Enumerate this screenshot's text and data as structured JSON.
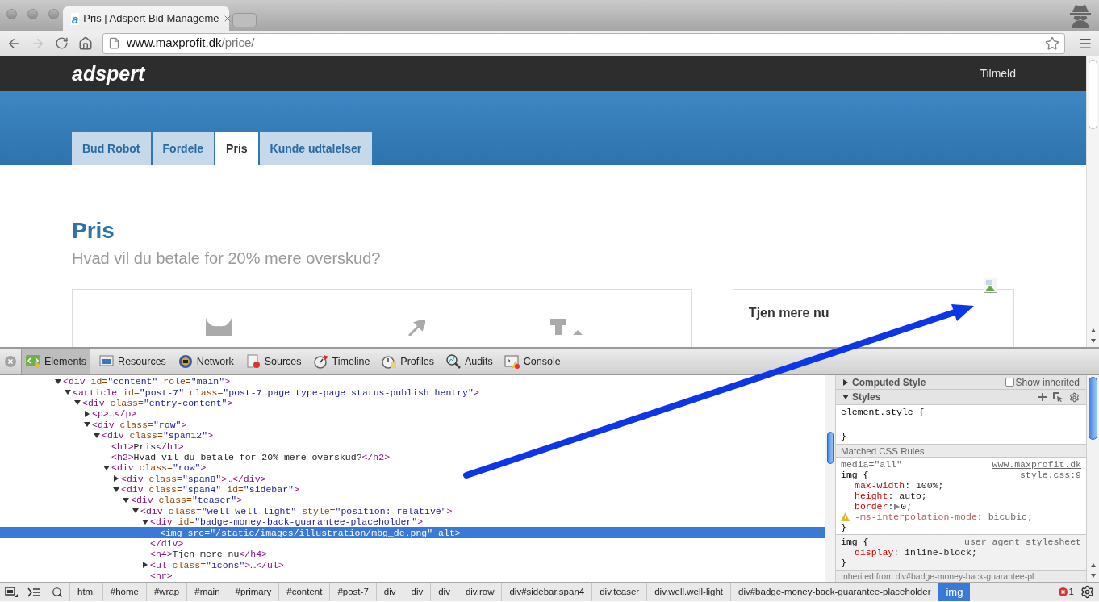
{
  "browser": {
    "tab": {
      "favicon_letter": "a",
      "title": "Pris | Adspert Bid Manageme"
    },
    "url": {
      "host": "www.maxprofit.dk",
      "path": "/price/"
    },
    "forward_disabled": true
  },
  "site": {
    "logo": "adspert",
    "signup": "Tilmeld",
    "nav": [
      {
        "label": "Bud Robot",
        "selected": false
      },
      {
        "label": "Fordele",
        "selected": false
      },
      {
        "label": "Pris",
        "selected": true
      },
      {
        "label": "Kunde udtalelser",
        "selected": false
      }
    ],
    "heading": "Pris",
    "subheading": "Hvad vil du betale for 20% mere overskud?",
    "sidebar_title": "Tjen mere nu"
  },
  "devtools": {
    "tabs": [
      {
        "label": "Elements",
        "selected": true
      },
      {
        "label": "Resources",
        "selected": false
      },
      {
        "label": "Network",
        "selected": false
      },
      {
        "label": "Sources",
        "selected": false
      },
      {
        "label": "Timeline",
        "selected": false
      },
      {
        "label": "Profiles",
        "selected": false
      },
      {
        "label": "Audits",
        "selected": false
      },
      {
        "label": "Console",
        "selected": false
      }
    ],
    "dom_tree": [
      {
        "expanded": true,
        "selected": false,
        "tokens": [
          {
            "kind": "tag",
            "text": "<div"
          },
          {
            "kind": "attr",
            "text": " id="
          },
          {
            "kind": "val",
            "text": "\"content\""
          },
          {
            "kind": "attr",
            "text": " role="
          },
          {
            "kind": "val",
            "text": "\"main\""
          },
          {
            "kind": "tag",
            "text": ">"
          }
        ],
        "children": [
          {
            "expanded": true,
            "selected": false,
            "tokens": [
              {
                "kind": "tag",
                "text": "<article"
              },
              {
                "kind": "attr",
                "text": " id="
              },
              {
                "kind": "val",
                "text": "\"post-7\""
              },
              {
                "kind": "attr",
                "text": " class="
              },
              {
                "kind": "val",
                "text": "\"post-7 page type-page status-publish hentry\""
              },
              {
                "kind": "tag",
                "text": ">"
              }
            ],
            "children": [
              {
                "expanded": true,
                "selected": false,
                "tokens": [
                  {
                    "kind": "tag",
                    "text": "<div"
                  },
                  {
                    "kind": "attr",
                    "text": " class="
                  },
                  {
                    "kind": "val",
                    "text": "\"entry-content\""
                  },
                  {
                    "kind": "tag",
                    "text": ">"
                  }
                ],
                "children": [
                  {
                    "expanded": false,
                    "selected": false,
                    "tokens": [
                      {
                        "kind": "tag",
                        "text": "<p>"
                      },
                      {
                        "kind": "text",
                        "text": "…"
                      },
                      {
                        "kind": "tag",
                        "text": "</p>"
                      }
                    ]
                  },
                  {
                    "expanded": true,
                    "selected": false,
                    "tokens": [
                      {
                        "kind": "tag",
                        "text": "<div"
                      },
                      {
                        "kind": "attr",
                        "text": " class="
                      },
                      {
                        "kind": "val",
                        "text": "\"row\""
                      },
                      {
                        "kind": "tag",
                        "text": ">"
                      }
                    ],
                    "children": [
                      {
                        "expanded": true,
                        "selected": false,
                        "tokens": [
                          {
                            "kind": "tag",
                            "text": "<div"
                          },
                          {
                            "kind": "attr",
                            "text": " class="
                          },
                          {
                            "kind": "val",
                            "text": "\"span12\""
                          },
                          {
                            "kind": "tag",
                            "text": ">"
                          }
                        ],
                        "children": [
                          {
                            "selected": false,
                            "tokens": [
                              {
                                "kind": "tag",
                                "text": "<h1>"
                              },
                              {
                                "kind": "text",
                                "text": "Pris"
                              },
                              {
                                "kind": "tag",
                                "text": "</h1>"
                              }
                            ]
                          },
                          {
                            "selected": false,
                            "tokens": [
                              {
                                "kind": "tag",
                                "text": "<h2>"
                              },
                              {
                                "kind": "text",
                                "text": "Hvad vil du betale for 20% mere overskud?"
                              },
                              {
                                "kind": "tag",
                                "text": "</h2>"
                              }
                            ]
                          },
                          {
                            "expanded": true,
                            "selected": false,
                            "tokens": [
                              {
                                "kind": "tag",
                                "text": "<div"
                              },
                              {
                                "kind": "attr",
                                "text": " class="
                              },
                              {
                                "kind": "val",
                                "text": "\"row\""
                              },
                              {
                                "kind": "tag",
                                "text": ">"
                              }
                            ],
                            "children": [
                              {
                                "expanded": false,
                                "selected": false,
                                "tokens": [
                                  {
                                    "kind": "tag",
                                    "text": "<div"
                                  },
                                  {
                                    "kind": "attr",
                                    "text": " class="
                                  },
                                  {
                                    "kind": "val",
                                    "text": "\"span8\""
                                  },
                                  {
                                    "kind": "tag",
                                    "text": ">"
                                  },
                                  {
                                    "kind": "text",
                                    "text": "…"
                                  },
                                  {
                                    "kind": "tag",
                                    "text": "</div>"
                                  }
                                ]
                              },
                              {
                                "expanded": true,
                                "selected": false,
                                "tokens": [
                                  {
                                    "kind": "tag",
                                    "text": "<div"
                                  },
                                  {
                                    "kind": "attr",
                                    "text": " class="
                                  },
                                  {
                                    "kind": "val",
                                    "text": "\"span4\""
                                  },
                                  {
                                    "kind": "attr",
                                    "text": " id="
                                  },
                                  {
                                    "kind": "val",
                                    "text": "\"sidebar\""
                                  },
                                  {
                                    "kind": "tag",
                                    "text": ">"
                                  }
                                ],
                                "children": [
                                  {
                                    "expanded": true,
                                    "selected": false,
                                    "tokens": [
                                      {
                                        "kind": "tag",
                                        "text": "<div"
                                      },
                                      {
                                        "kind": "attr",
                                        "text": " class="
                                      },
                                      {
                                        "kind": "val",
                                        "text": "\"teaser\""
                                      },
                                      {
                                        "kind": "tag",
                                        "text": ">"
                                      }
                                    ],
                                    "children": [
                                      {
                                        "expanded": true,
                                        "selected": false,
                                        "tokens": [
                                          {
                                            "kind": "tag",
                                            "text": "<div"
                                          },
                                          {
                                            "kind": "attr",
                                            "text": " class="
                                          },
                                          {
                                            "kind": "val",
                                            "text": "\"well well-light\""
                                          },
                                          {
                                            "kind": "attr",
                                            "text": " style="
                                          },
                                          {
                                            "kind": "val",
                                            "text": "\"position: relative\""
                                          },
                                          {
                                            "kind": "tag",
                                            "text": ">"
                                          }
                                        ],
                                        "children": [
                                          {
                                            "expanded": true,
                                            "selected": false,
                                            "tokens": [
                                              {
                                                "kind": "tag",
                                                "text": "<div"
                                              },
                                              {
                                                "kind": "attr",
                                                "text": " id="
                                              },
                                              {
                                                "kind": "val",
                                                "text": "\"badge-money-back-guarantee-placeholder\""
                                              },
                                              {
                                                "kind": "tag",
                                                "text": ">"
                                              }
                                            ],
                                            "children": [
                                              {
                                                "selected": true,
                                                "tokens": [
                                                  {
                                                    "kind": "tag",
                                                    "text": "<img"
                                                  },
                                                  {
                                                    "kind": "attr",
                                                    "text": " src="
                                                  },
                                                  {
                                                    "kind": "val",
                                                    "text": "\""
                                                  },
                                                  {
                                                    "kind": "link",
                                                    "text": "/static/images/illustration/mbg_de.png"
                                                  },
                                                  {
                                                    "kind": "val",
                                                    "text": "\""
                                                  },
                                                  {
                                                    "kind": "attr",
                                                    "text": " alt"
                                                  },
                                                  {
                                                    "kind": "tag",
                                                    "text": ">"
                                                  }
                                                ]
                                              }
                                            ]
                                          },
                                          {
                                            "selected": false,
                                            "tokens": [
                                              {
                                                "kind": "tag",
                                                "text": "</div>"
                                              }
                                            ]
                                          },
                                          {
                                            "selected": false,
                                            "tokens": [
                                              {
                                                "kind": "tag",
                                                "text": "<h4>"
                                              },
                                              {
                                                "kind": "text",
                                                "text": "Tjen mere nu"
                                              },
                                              {
                                                "kind": "tag",
                                                "text": "</h4>"
                                              }
                                            ]
                                          },
                                          {
                                            "expanded": false,
                                            "selected": false,
                                            "tokens": [
                                              {
                                                "kind": "tag",
                                                "text": "<ul"
                                              },
                                              {
                                                "kind": "attr",
                                                "text": " class="
                                              },
                                              {
                                                "kind": "val",
                                                "text": "\"icons\""
                                              },
                                              {
                                                "kind": "tag",
                                                "text": ">"
                                              },
                                              {
                                                "kind": "text",
                                                "text": "…"
                                              },
                                              {
                                                "kind": "tag",
                                                "text": "</ul>"
                                              }
                                            ]
                                          },
                                          {
                                            "selected": false,
                                            "tokens": [
                                              {
                                                "kind": "tag",
                                                "text": "<hr>"
                                              }
                                            ]
                                          }
                                        ]
                                      }
                                    ]
                                  }
                                ]
                              }
                            ]
                          }
                        ]
                      }
                    ]
                  }
                ]
              }
            ]
          }
        ]
      }
    ],
    "styles": {
      "computed": {
        "label": "Computed Style",
        "expanded": false
      },
      "show_inherited": {
        "label": "Show inherited",
        "checked": false
      },
      "styles_header": {
        "label": "Styles",
        "expanded": true
      },
      "element_style": {
        "selector": "element.style {",
        "close": "}"
      },
      "matched_label": "Matched CSS Rules",
      "rules": [
        {
          "kind": "author",
          "media": "media=\"all\"",
          "selector": "img {",
          "source": [
            "www.maxprofit.dk",
            "style.css:9"
          ],
          "close": "}",
          "properties": [
            {
              "name": "max-width",
              "colon": ":",
              "value": " 100%;",
              "expandable": false,
              "overridden": false,
              "warning": false
            },
            {
              "name": "height",
              "colon": ":",
              "value": " auto;",
              "expandable": false,
              "overridden": false,
              "warning": false
            },
            {
              "name": "border",
              "colon": ":",
              "value": "0;",
              "expandable": true,
              "overridden": false,
              "warning": false
            },
            {
              "name": "-ms-interpolation-mode",
              "colon": ":",
              "value": " bicubic;",
              "expandable": false,
              "overridden": true,
              "warning": true
            }
          ]
        },
        {
          "kind": "user_agent",
          "selector": "img {",
          "source": [
            "user agent stylesheet"
          ],
          "close": "}",
          "properties": [
            {
              "name": "display",
              "colon": ":",
              "value": " inline-block;",
              "expandable": false,
              "overridden": false,
              "warning": false
            }
          ]
        }
      ],
      "inherited_label": "Inherited from div#badge-money-back-guarantee-pl"
    },
    "breadcrumbs": [
      {
        "label": "html",
        "selected": false
      },
      {
        "label": "#home",
        "selected": false
      },
      {
        "label": "#wrap",
        "selected": false
      },
      {
        "label": "#main",
        "selected": false
      },
      {
        "label": "#primary",
        "selected": false
      },
      {
        "label": "#content",
        "selected": false
      },
      {
        "label": "#post-7",
        "selected": false
      },
      {
        "label": "div",
        "selected": false
      },
      {
        "label": "div",
        "selected": false
      },
      {
        "label": "div",
        "selected": false
      },
      {
        "label": "div.row",
        "selected": false
      },
      {
        "label": "div#sidebar.span4",
        "selected": false
      },
      {
        "label": "div.teaser",
        "selected": false
      },
      {
        "label": "div.well.well-light",
        "selected": false
      },
      {
        "label": "div#badge-money-back-guarantee-placeholder",
        "selected": false
      },
      {
        "label": "img",
        "selected": true
      }
    ],
    "error_count": "1"
  }
}
